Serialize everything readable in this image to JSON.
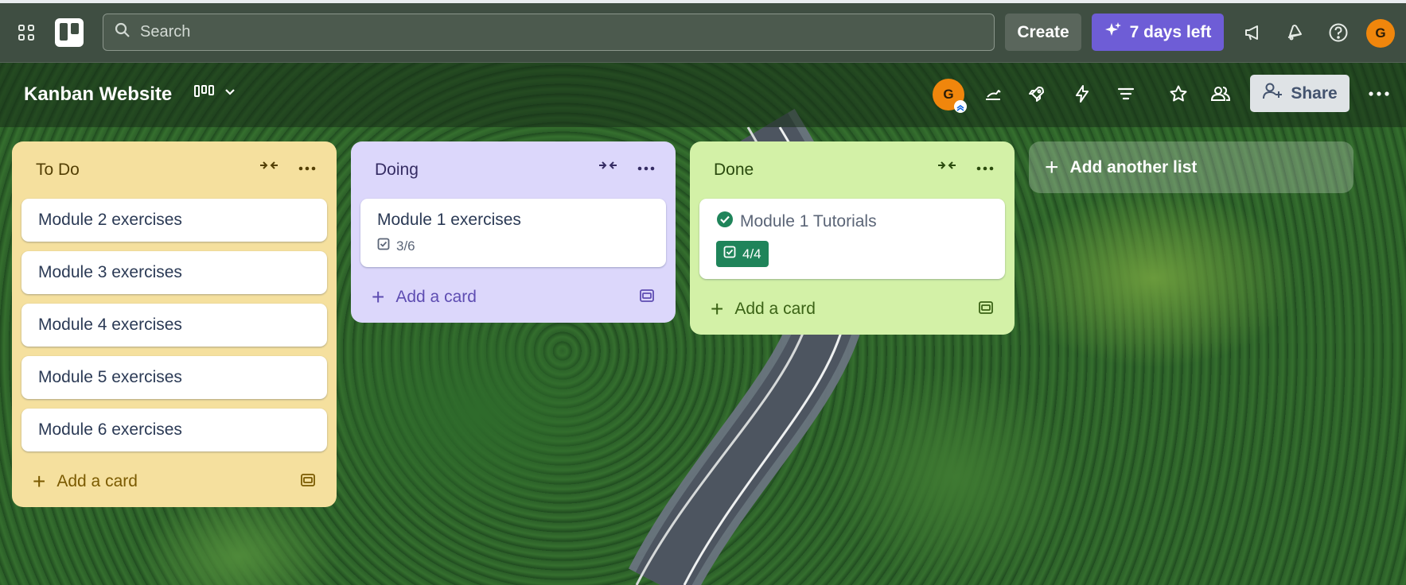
{
  "topnav": {
    "search_placeholder": "Search",
    "create_label": "Create",
    "trial_label": "7 days left",
    "avatar_initial": "G"
  },
  "board": {
    "title": "Kanban Website",
    "member_initial": "G",
    "share_label": "Share"
  },
  "lists": [
    {
      "title": "To Do",
      "bg": "#f5e09e",
      "accent": "#7a5a00",
      "cards": [
        {
          "title": "Module 2 exercises"
        },
        {
          "title": "Module 3 exercises"
        },
        {
          "title": "Module 4 exercises"
        },
        {
          "title": "Module 5 exercises"
        },
        {
          "title": "Module 6 exercises"
        }
      ],
      "add_card_label": "Add a card"
    },
    {
      "title": "Doing",
      "bg": "#dcd7fb",
      "accent": "#5e4db2",
      "cards": [
        {
          "title": "Module 1 exercises",
          "checklist": "3/6"
        }
      ],
      "add_card_label": "Add a card"
    },
    {
      "title": "Done",
      "bg": "#d3f1a7",
      "accent": "#3b6316",
      "cards": [
        {
          "title": "Module 1 Tutorials",
          "checklist": "4/4",
          "completed": true
        }
      ],
      "add_card_label": "Add a card"
    }
  ],
  "add_list_label": "Add another list",
  "colors": {
    "topnav_bg": "#3f4e42",
    "trial_purple": "#6e5dd6",
    "avatar_orange": "#f0860c",
    "done_green": "#1f845a"
  }
}
